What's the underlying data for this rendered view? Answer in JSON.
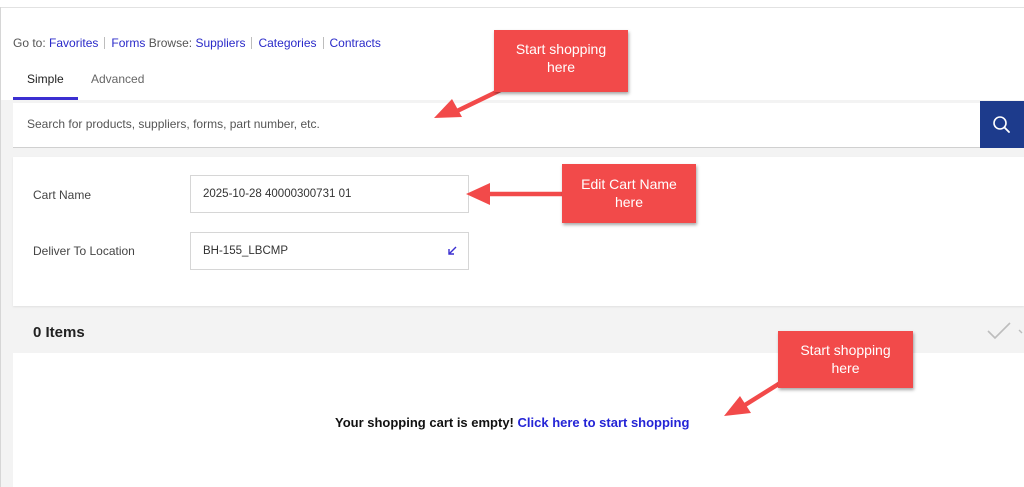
{
  "nav": {
    "goto_label": "Go to:",
    "favorites": "Favorites",
    "forms": "Forms",
    "browse_label": "Browse:",
    "suppliers": "Suppliers",
    "categories": "Categories",
    "contracts": "Contracts"
  },
  "tabs": [
    {
      "label": "Simple",
      "active": true
    },
    {
      "label": "Advanced",
      "active": false
    }
  ],
  "search": {
    "placeholder": "Search for products, suppliers, forms, part number, etc.",
    "button_icon": "search-icon"
  },
  "cart": {
    "name_label": "Cart Name",
    "name_value": "2025-10-28 40000300731 01",
    "deliver_label": "Deliver To Location",
    "deliver_value": "BH-155_LBCMP",
    "deliver_icon": "arrow-down-left-icon"
  },
  "items": {
    "count_label": "0 Items",
    "check_icon": "checkmark-icon"
  },
  "empty": {
    "message": "Your shopping cart is empty!",
    "link": "Click here to start shopping"
  },
  "annotations": [
    {
      "line1": "Start shopping",
      "line2": "here"
    },
    {
      "line1": "Edit Cart Name",
      "line2": "here"
    },
    {
      "line1": "Start shopping",
      "line2": "here"
    }
  ],
  "colors": {
    "link": "#2a2ac9",
    "accent": "#3b2fd1",
    "search_button": "#1d3b8c",
    "callout": "#f24a4a"
  }
}
